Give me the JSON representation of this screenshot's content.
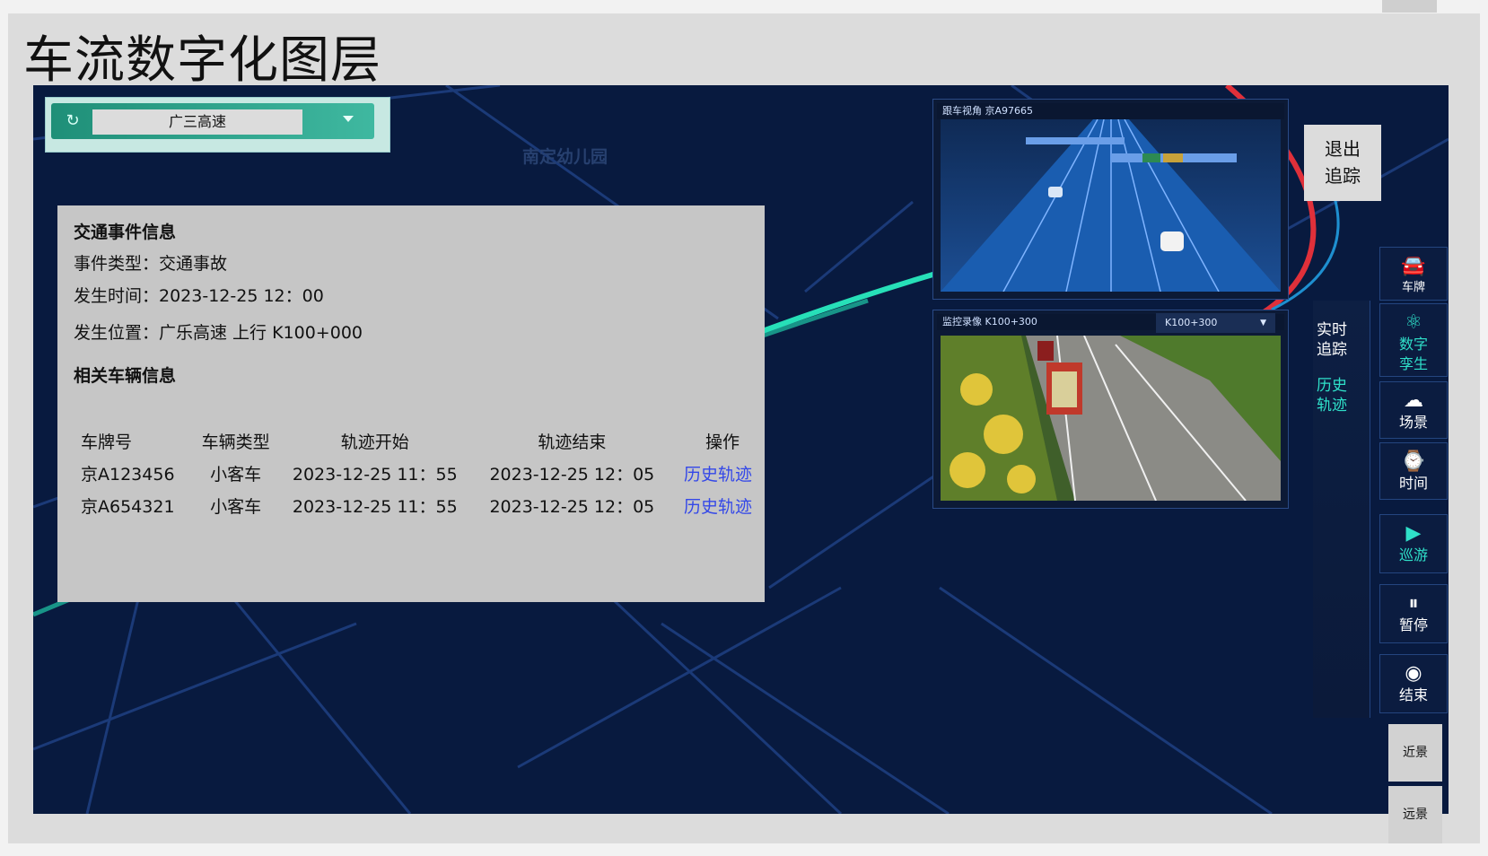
{
  "page": {
    "title": "车流数字化图层"
  },
  "map": {
    "poi_label": "南定幼儿园"
  },
  "selector": {
    "value": "广三高速",
    "refresh_icon": "refresh-icon",
    "caret_icon": "chevron-down-icon"
  },
  "event_panel": {
    "section_title": "交通事件信息",
    "event_type": "事件类型：交通事故",
    "time": "发生时间：2023-12-25 12：00",
    "location": "发生位置：广乐高速 上行 K100+000",
    "vehicle_section_title": "相关车辆信息",
    "columns": [
      "车牌号",
      "车辆类型",
      "轨迹开始",
      "轨迹结束",
      "操作"
    ],
    "rows": [
      {
        "plate": "京A123456",
        "type": "小客车",
        "start": "2023-12-25 11：55",
        "end": "2023-12-25 12：05",
        "action": "历史轨迹"
      },
      {
        "plate": "京A654321",
        "type": "小客车",
        "start": "2023-12-25 11：55",
        "end": "2023-12-25 12：05",
        "action": "历史轨迹"
      }
    ]
  },
  "video_follow": {
    "label": "跟车视角  京A97665"
  },
  "video_monitor": {
    "label": "监控录像  K100+300",
    "select_value": "K100+300"
  },
  "exit_button": {
    "line1": "退出",
    "line2": "追踪"
  },
  "submenu": {
    "realtime": [
      "实时",
      "追踪"
    ],
    "history": [
      "历史",
      "轨迹"
    ]
  },
  "toolbar": {
    "plate": {
      "icon": "car-icon",
      "label": "车牌"
    },
    "twin": {
      "icon": "atom-icon",
      "label1": "数字",
      "label2": "孪生"
    },
    "scene": {
      "icon": "cloud-icon",
      "label": "场景"
    },
    "time": {
      "icon": "time-icon",
      "label": "时间"
    },
    "cruise": {
      "icon": "play-icon",
      "label": "巡游"
    },
    "pause": {
      "icon": "pause-icon",
      "label": "暂停"
    },
    "end": {
      "icon": "eye-icon",
      "label": "结束"
    }
  },
  "view_buttons": {
    "near": "近景",
    "far": "远景"
  },
  "colors": {
    "map_bg": "#081a3f",
    "accent_teal": "#2fe0c9",
    "link_blue": "#3448e8",
    "route_red": "#e0303a"
  }
}
